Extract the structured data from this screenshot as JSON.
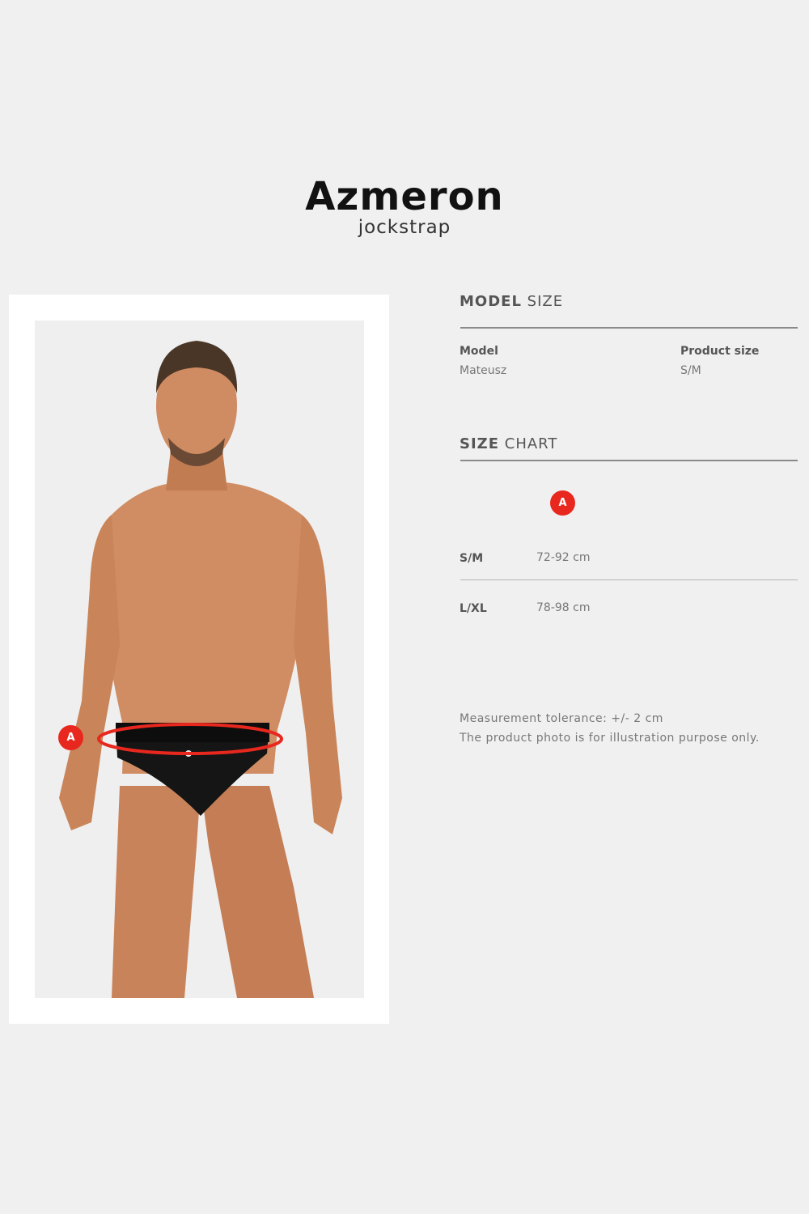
{
  "product": {
    "name": "Azmeron",
    "type": "jockstrap"
  },
  "model_size": {
    "heading_bold": "MODEL",
    "heading_light": "SIZE",
    "model_label": "Model",
    "model_value": "Mateusz",
    "product_size_label": "Product size",
    "product_size_value": "S/M"
  },
  "size_chart": {
    "heading_bold": "SIZE",
    "heading_light": "CHART",
    "column_marker": "A",
    "rows": [
      {
        "size": "S/M",
        "measure": "72-92 cm"
      },
      {
        "size": "L/XL",
        "measure": "78-98 cm"
      }
    ]
  },
  "photo": {
    "marker": "A"
  },
  "notes": {
    "tolerance": "Measurement tolerance: +/- 2 cm",
    "disclaimer": "The product photo is for illustration purpose only."
  },
  "colors": {
    "accent": "#e8281e",
    "background": "#f0f0f0"
  }
}
